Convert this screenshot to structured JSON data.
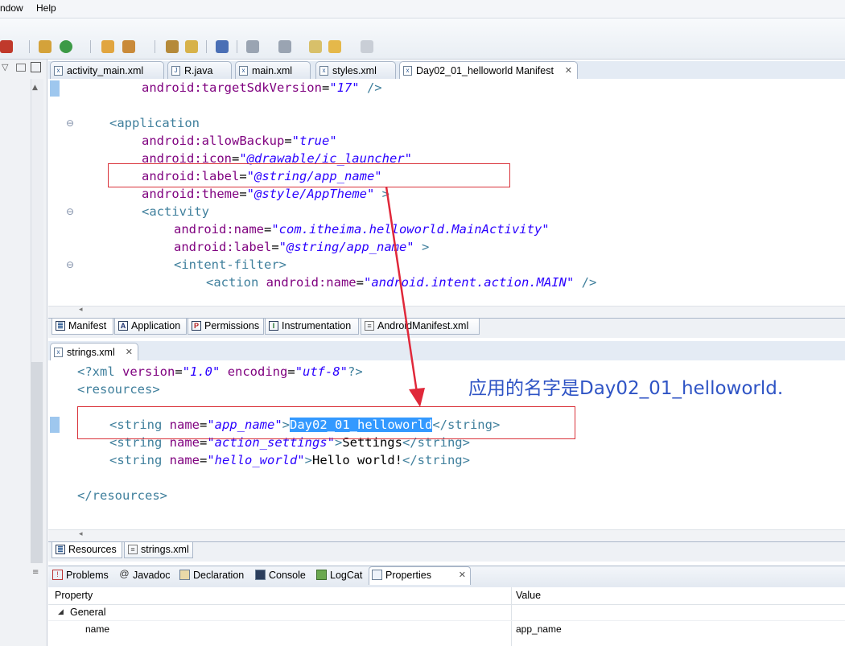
{
  "menu": {
    "window": "ndow",
    "help": "Help"
  },
  "editor_tabs": [
    {
      "label": "activity_main.xml"
    },
    {
      "label": "R.java"
    },
    {
      "label": "main.xml"
    },
    {
      "label": "styles.xml"
    },
    {
      "label": "Day02_01_helloworld Manifest",
      "close": "✕"
    }
  ],
  "manifest_code": {
    "line1": {
      "attr": "android:targetSdkVersion",
      "eq": "=",
      "val": "\"17\"",
      "end": " />"
    },
    "line2": {
      "tag": "<application"
    },
    "line3": {
      "attr": "android:allowBackup",
      "eq": "=",
      "val": "\"true\""
    },
    "line4": {
      "attr": "android:icon",
      "eq": "=",
      "val": "\"@drawable/ic_launcher\""
    },
    "line5": {
      "attr": "android:label",
      "eq": "=",
      "val": "\"@string/app_name\""
    },
    "line6": {
      "attr": "android:theme",
      "eq": "=",
      "val": "\"@style/AppTheme\"",
      "end": " >"
    },
    "line7": {
      "tag": "<activity"
    },
    "line8": {
      "attr": "android:name",
      "eq": "=",
      "val": "\"com.itheima.helloworld.MainActivity\""
    },
    "line9": {
      "attr": "android:label",
      "eq": "=",
      "val": "\"@string/app_name\"",
      "end": " >"
    },
    "line10": {
      "tag": "<intent-filter>"
    },
    "line11": {
      "tag": "<action ",
      "attr": "android:name",
      "eq": "=",
      "val": "\"android.intent.action.MAIN\"",
      "end": " />"
    }
  },
  "manifest_bottom_tabs": [
    {
      "icon": "≣",
      "label": "Manifest"
    },
    {
      "icon": "A",
      "label": "Application"
    },
    {
      "icon": "P",
      "label": "Permissions"
    },
    {
      "icon": "I",
      "label": "Instrumentation"
    },
    {
      "icon": "≡",
      "label": "AndroidManifest.xml"
    }
  ],
  "strings_tab": {
    "label": "strings.xml",
    "close": "✕"
  },
  "strings_code": {
    "decl_open": "<?xml ",
    "decl_attr1": "version",
    "decl_val1": "\"1.0\"",
    "decl_attr2": "encoding",
    "decl_val2": "\"utf-8\"",
    "decl_close": "?>",
    "res_open": "<resources>",
    "s1": {
      "open": "<string ",
      "attr": "name",
      "eq": "=",
      "val": "\"app_name\"",
      "gt": ">",
      "text": "Day02_01_helloworld",
      "close": "</string>"
    },
    "s2": {
      "open": "<string ",
      "attr": "name",
      "eq": "=",
      "val": "\"action_settings\"",
      "gt": ">",
      "text": "Settings",
      "close": "</string>"
    },
    "s3": {
      "open": "<string ",
      "attr": "name",
      "eq": "=",
      "val": "\"hello_world\"",
      "gt": ">",
      "text": "Hello world!",
      "close": "</string>"
    },
    "res_close": "</resources>"
  },
  "annotation": "应用的名字是Day02_01_helloworld.",
  "strings_bottom_tabs": [
    {
      "icon": "≣",
      "label": "Resources"
    },
    {
      "icon": "≡",
      "label": "strings.xml"
    }
  ],
  "panel_tabs": [
    {
      "label": "Problems"
    },
    {
      "label": "Javadoc"
    },
    {
      "label": "Declaration"
    },
    {
      "label": "Console"
    },
    {
      "label": "LogCat"
    },
    {
      "label": "Properties",
      "close": "✕"
    }
  ],
  "properties": {
    "header_property": "Property",
    "header_value": "Value",
    "group": "General",
    "row_name": "name",
    "row_value": "app_name"
  },
  "colors": {
    "annotation": "#2f54c5",
    "highlight_box": "#d9323a",
    "selection": "#3399ff"
  }
}
